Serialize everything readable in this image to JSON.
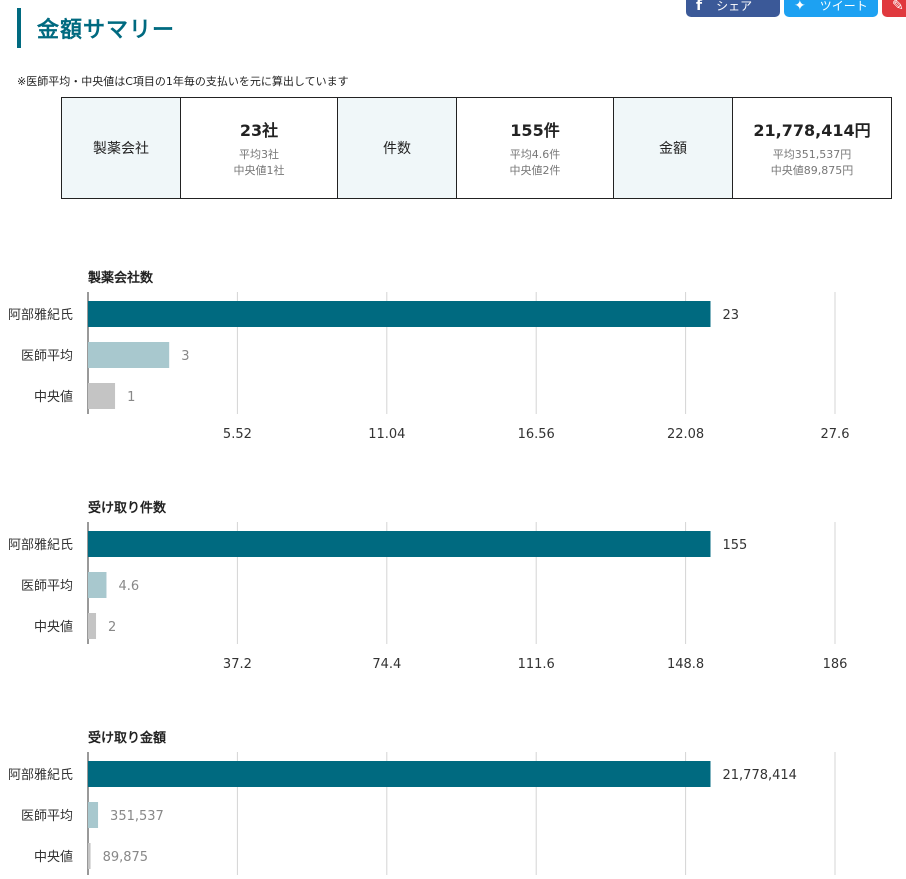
{
  "share": {
    "facebook_label": "シェア",
    "twitter_label": "ツイート"
  },
  "header": {
    "title": "金額サマリー"
  },
  "note": "※医師平均・中央値はC項目の1年毎の支払いを元に算出しています",
  "summary": [
    {
      "label": "製薬会社",
      "value": "23社",
      "avg": "平均3社",
      "median": "中央値1社"
    },
    {
      "label": "件数",
      "value": "155件",
      "avg": "平均4.6件",
      "median": "中央値2件"
    },
    {
      "label": "金額",
      "value": "21,778,414円",
      "avg": "平均351,537円",
      "median": "中央値89,875円"
    }
  ],
  "colors": {
    "primary": "#006a80",
    "average": "#a8c8ce",
    "median": "#c4c4c4"
  },
  "chart_data": [
    {
      "type": "bar",
      "orientation": "horizontal",
      "title": "製薬会社数",
      "categories": [
        "阿部雅紀氏",
        "医師平均",
        "中央値"
      ],
      "values": [
        23,
        3,
        1
      ],
      "value_labels": [
        "23",
        "3",
        "1"
      ],
      "xlim": [
        0,
        27.6
      ],
      "ticks": [
        5.52,
        11.04,
        16.56,
        22.08,
        27.6
      ],
      "tick_labels": [
        "5.52",
        "11.04",
        "16.56",
        "22.08",
        "27.6"
      ],
      "grid": true
    },
    {
      "type": "bar",
      "orientation": "horizontal",
      "title": "受け取り件数",
      "categories": [
        "阿部雅紀氏",
        "医師平均",
        "中央値"
      ],
      "values": [
        155,
        4.6,
        2
      ],
      "value_labels": [
        "155",
        "4.6",
        "2"
      ],
      "xlim": [
        0,
        186
      ],
      "ticks": [
        37.2,
        74.4,
        111.6,
        148.8,
        186
      ],
      "tick_labels": [
        "37.2",
        "74.4",
        "111.6",
        "148.8",
        "186"
      ],
      "grid": true
    },
    {
      "type": "bar",
      "orientation": "horizontal",
      "title": "受け取り金額",
      "categories": [
        "阿部雅紀氏",
        "医師平均",
        "中央値"
      ],
      "values": [
        21778414,
        351537,
        89875
      ],
      "value_labels": [
        "21,778,414",
        "351,537",
        "89,875"
      ],
      "xlim": [
        0,
        26134096.8
      ],
      "ticks": [
        5226819.36,
        10453638.72,
        15680458.08,
        20907277.44,
        26134096.8
      ],
      "tick_labels": [],
      "grid": true
    }
  ]
}
